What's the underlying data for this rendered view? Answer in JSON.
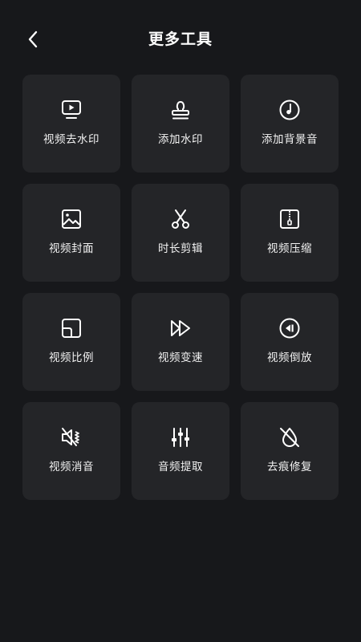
{
  "header": {
    "title": "更多工具",
    "back_icon": "chevron-left-icon"
  },
  "colors": {
    "background": "#17181b",
    "tile": "#242528",
    "text": "#ffffff"
  },
  "tools": [
    {
      "label": "视频去水印",
      "icon": "tv-play-icon"
    },
    {
      "label": "添加水印",
      "icon": "stamp-icon"
    },
    {
      "label": "添加背景音",
      "icon": "music-disc-icon"
    },
    {
      "label": "视频封面",
      "icon": "image-icon"
    },
    {
      "label": "时长剪辑",
      "icon": "scissors-icon"
    },
    {
      "label": "视频压缩",
      "icon": "zip-file-icon"
    },
    {
      "label": "视频比例",
      "icon": "aspect-ratio-icon"
    },
    {
      "label": "视频变速",
      "icon": "fast-forward-icon"
    },
    {
      "label": "视频倒放",
      "icon": "rewind-circle-icon"
    },
    {
      "label": "视频消音",
      "icon": "mute-speaker-icon"
    },
    {
      "label": "音频提取",
      "icon": "equalizer-sliders-icon"
    },
    {
      "label": "去痕修复",
      "icon": "drop-off-icon"
    }
  ]
}
